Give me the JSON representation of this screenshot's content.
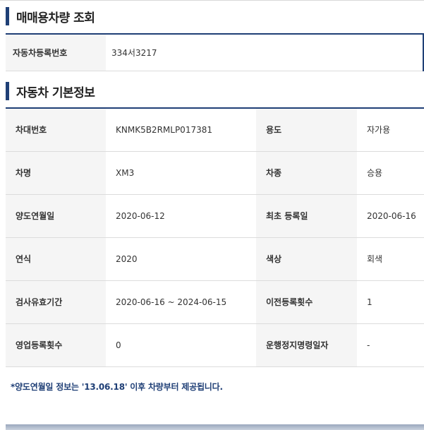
{
  "search_section": {
    "title": "매매용차량 조회",
    "label": "자동차등록번호",
    "value": "334서3217"
  },
  "info_section": {
    "title": "자동차 기본정보",
    "rows": [
      {
        "l1": "차대번호",
        "v1": "KNMK5B2RMLP017381",
        "l2": "용도",
        "v2": "자가용"
      },
      {
        "l1": "차명",
        "v1": "XM3",
        "l2": "차종",
        "v2": "승용"
      },
      {
        "l1": "양도연월일",
        "v1": "2020-06-12",
        "l2": "최초 등록일",
        "v2": "2020-06-16"
      },
      {
        "l1": "연식",
        "v1": "2020",
        "l2": "색상",
        "v2": "회색"
      },
      {
        "l1": "검사유효기간",
        "v1": "2020-06-16 ~ 2024-06-15",
        "l2": "이전등록횟수",
        "v2": "1"
      },
      {
        "l1": "영업등록횟수",
        "v1": "0",
        "l2": "운행정지명령일자",
        "v2": "-"
      }
    ]
  },
  "note": "*양도연월일 정보는 '13.06.18' 이후 차량부터 제공됩니다.",
  "colors": {
    "accent": "#1f3f76",
    "header_bg": "#f5f5f5"
  }
}
